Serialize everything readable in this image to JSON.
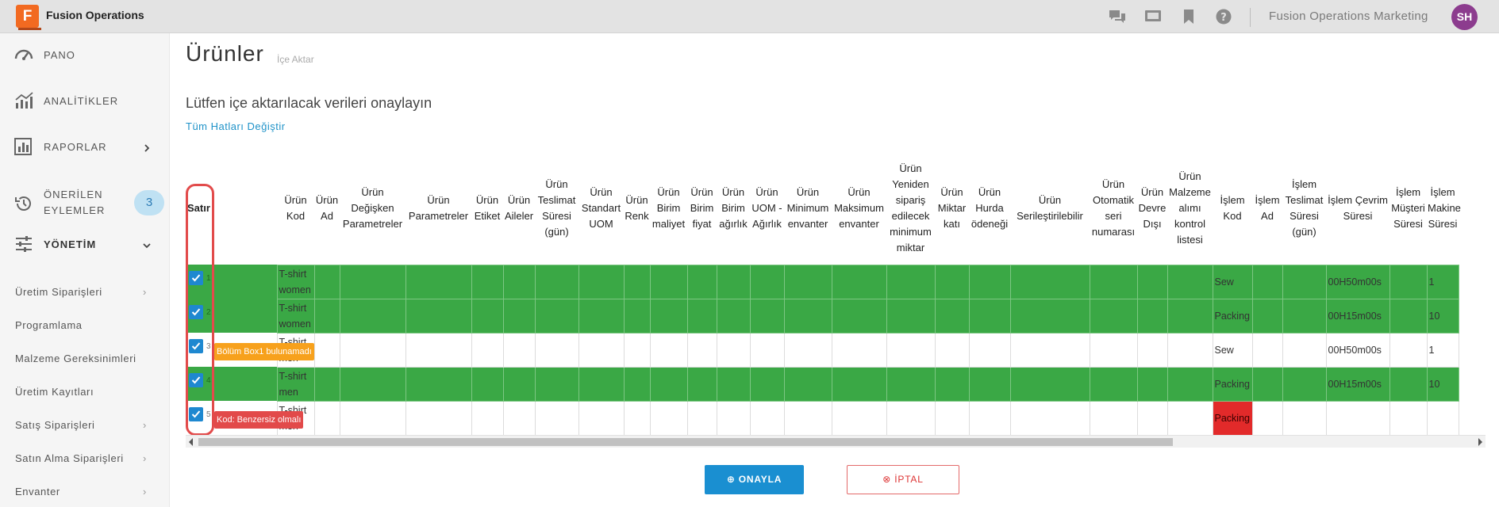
{
  "app": {
    "logo_letter": "F",
    "title": "Fusion Operations",
    "org": "Fusion Operations Marketing",
    "avatar": "SH"
  },
  "topbar_icons": [
    "chat-icon",
    "screen-icon",
    "bookmark-icon",
    "help-icon"
  ],
  "sidebar": {
    "items": [
      {
        "label": "PANO",
        "icon": "dashboard-icon"
      },
      {
        "label": "ANALİTİKLER",
        "icon": "analytics-icon"
      },
      {
        "label": "RAPORLAR",
        "icon": "reports-icon"
      },
      {
        "label": "ÖNERİLEN EYLEMLER",
        "line1": "ÖNERİLEN",
        "line2": "EYLEMLER",
        "icon": "history-icon",
        "badge": "3"
      },
      {
        "label": "YÖNETİM",
        "icon": "sliders-icon"
      }
    ],
    "sub_items": [
      {
        "label": "Üretim Siparişleri",
        "chevron": true
      },
      {
        "label": "Programlama",
        "chevron": false
      },
      {
        "label": "Malzeme Gereksinimleri",
        "chevron": false
      },
      {
        "label": "Üretim Kayıtları",
        "chevron": false
      },
      {
        "label": "Satış Siparişleri",
        "chevron": true
      },
      {
        "label": "Satın Alma Siparişleri",
        "chevron": true
      },
      {
        "label": "Envanter",
        "chevron": true
      }
    ]
  },
  "page": {
    "title": "Ürünler",
    "subtitle": "İçe Aktar",
    "confirm_text": "Lütfen içe aktarılacak verileri onaylayın",
    "toggle_errors": "Tüm Hatları Değiştir"
  },
  "table": {
    "headers": [
      "Satır",
      "",
      "Ürün Kod",
      "Ürün Ad",
      "Ürün Değişken Parametreler",
      "Ürün Parametreler",
      "Ürün Etiket",
      "Ürün Aileler",
      "Ürün Teslimat Süresi (gün)",
      "Ürün Standart UOM",
      "Ürün Renk",
      "Ürün Birim maliyet",
      "Ürün Birim fiyat",
      "Ürün Birim ağırlık",
      "Ürün UOM - Ağırlık",
      "Ürün Minimum envanter",
      "Ürün Maksimum envanter",
      "Ürün Yeniden sipariş edilecek minimum miktar",
      "Ürün Miktar katı",
      "Ürün Hurda ödeneği",
      "Ürün Serileştirilebilir",
      "Ürün Otomatik seri numarası",
      "Ürün Devre Dışı",
      "Ürün Malzeme alımı kontrol listesi",
      "İşlem Kod",
      "İşlem Ad",
      "İşlem Teslimat Süresi (gün)",
      "İşlem Çevrim Süresi",
      "İşlem Müşteri Süresi",
      "İşlem Makine Süresi"
    ],
    "rows": [
      {
        "num": "1",
        "checked": true,
        "status": "ok",
        "error": "",
        "kod": "T-shirt women",
        "islem_kod": "Sew",
        "cevrim": "00H50m00s",
        "last": "1"
      },
      {
        "num": "2",
        "checked": true,
        "status": "ok",
        "error": "",
        "kod": "T-shirt women",
        "islem_kod": "Packing",
        "cevrim": "00H15m00s",
        "last": "10"
      },
      {
        "num": "3",
        "checked": true,
        "status": "warn",
        "error": "Bölüm Box1 bulunamadı",
        "kod": "T-shirt men",
        "islem_kod": "Sew",
        "cevrim": "00H50m00s",
        "last": "1"
      },
      {
        "num": "4",
        "checked": true,
        "status": "ok",
        "error": "",
        "kod": "T-shirt men",
        "islem_kod": "Packing",
        "cevrim": "00H15m00s",
        "last": "10"
      },
      {
        "num": "5",
        "checked": true,
        "status": "error",
        "error": "Kod: Benzersiz olmalı",
        "kod": "T-shirt men",
        "islem_kod": "Packing",
        "cevrim": "",
        "last": ""
      }
    ]
  },
  "buttons": {
    "confirm": "⊕ ONAYLA",
    "cancel": "⊗ İPTAL"
  },
  "colors": {
    "ok_row": "#3aa845",
    "error_cell": "#e22a2a",
    "warn_badge": "#f7a11c",
    "error_badge": "#e24a4a",
    "accent": "#1a8fd1"
  }
}
